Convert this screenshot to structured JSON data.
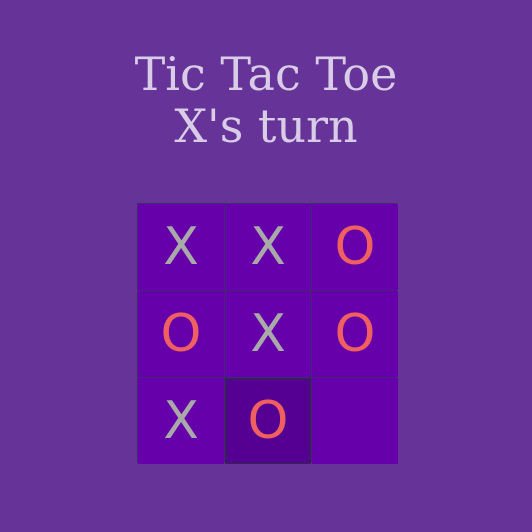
{
  "title": "Tic Tac Toe",
  "status": "X's turn",
  "board": [
    [
      "X",
      "X",
      "O"
    ],
    [
      "O",
      "X",
      "O"
    ],
    [
      "X",
      "O",
      ""
    ]
  ],
  "last_move": {
    "row": 2,
    "col": 1
  },
  "colors": {
    "background": "#663399",
    "cell": "#6600aa",
    "last_move_cell": "#550092",
    "grid_line": "#442670",
    "text": "#d8cce6",
    "x_mark": "#a9a9a9",
    "o_mark": "#f06060"
  }
}
